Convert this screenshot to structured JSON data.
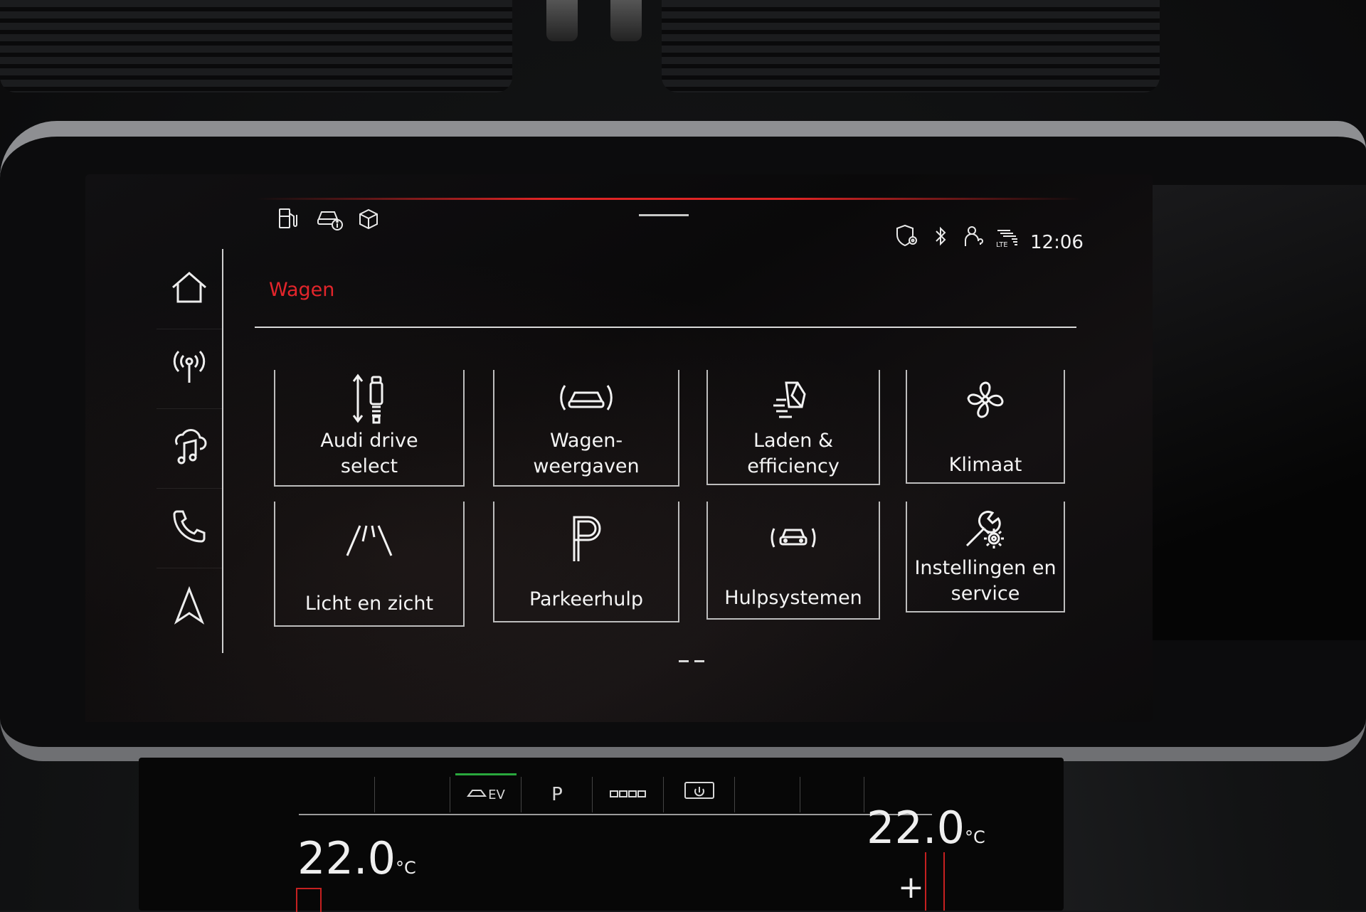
{
  "status_bar": {
    "icons": [
      "fuel-icon",
      "car-info-icon",
      "package-icon",
      "location-shield-icon",
      "bluetooth-icon",
      "person-help-icon",
      "lte-signal-icon"
    ],
    "time": "12:06"
  },
  "sidebar": {
    "items": [
      {
        "name": "home",
        "icon": "home-icon"
      },
      {
        "name": "radio",
        "icon": "antenna-icon"
      },
      {
        "name": "media",
        "icon": "music-note-icon"
      },
      {
        "name": "phone",
        "icon": "phone-icon"
      },
      {
        "name": "navigation",
        "icon": "navigation-arrow-icon"
      }
    ]
  },
  "header": {
    "title": "Wagen"
  },
  "tiles": [
    {
      "label_lines": [
        "Audi drive",
        "select"
      ],
      "icon": "drive-select-icon"
    },
    {
      "label_lines": [
        "Wagen-",
        "weergaven"
      ],
      "icon": "car-view-icon"
    },
    {
      "label_lines": [
        "Laden &",
        "efficiency"
      ],
      "icon": "charging-efficiency-icon"
    },
    {
      "label_lines": [
        "Klimaat"
      ],
      "icon": "fan-icon"
    },
    {
      "label_lines": [
        "Licht en zicht"
      ],
      "icon": "light-vision-icon"
    },
    {
      "label_lines": [
        "Parkeerhulp"
      ],
      "icon": "parking-icon"
    },
    {
      "label_lines": [
        "Hulpsystemen"
      ],
      "icon": "assist-systems-icon"
    },
    {
      "label_lines": [
        "Instellingen en",
        "service"
      ],
      "icon": "settings-wrench-icon"
    }
  ],
  "pagination": {
    "pages": 2
  },
  "climate": {
    "tabs": [
      "EV",
      "P",
      "",
      ""
    ],
    "left_temp": "22.0",
    "left_unit": "°C",
    "right_temp": "22.0",
    "right_unit": "°C",
    "plus_label": "+"
  },
  "colors": {
    "accent_red": "#e3252b",
    "ev_green": "#29a83d"
  }
}
